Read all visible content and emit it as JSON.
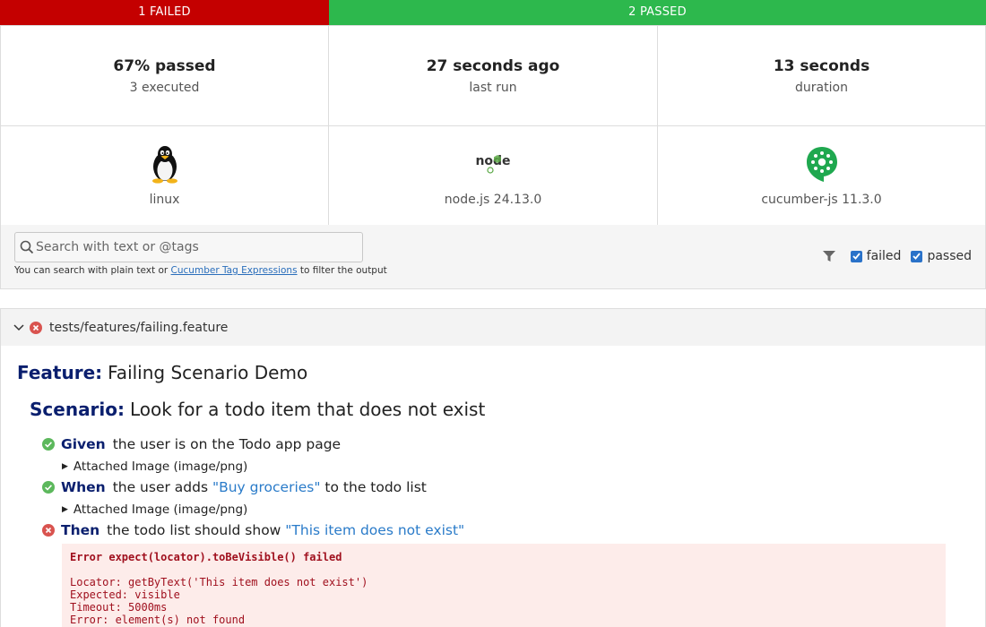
{
  "status_bar": {
    "failed_label": "1 FAILED",
    "passed_label": "2 PASSED",
    "failed_color": "#c40000",
    "passed_color": "#2db84d"
  },
  "stats": {
    "passed_pct": "67% passed",
    "executed": "3 executed",
    "last_run_value": "27 seconds ago",
    "last_run_label": "last run",
    "duration_value": "13 seconds",
    "duration_label": "duration"
  },
  "environment": {
    "os": "linux",
    "os_icon": "linux-tux-icon",
    "runtime": "node.js 24.13.0",
    "runtime_icon": "nodejs-icon",
    "runtime_logo_text": "node",
    "framework": "cucumber-js 11.3.0",
    "framework_icon": "cucumber-icon"
  },
  "search": {
    "placeholder": "Search with text or @tags",
    "help_prefix": "You can search with plain text or ",
    "help_link": "Cucumber Tag Expressions",
    "help_suffix": " to filter the output"
  },
  "filters": {
    "failed_label": "failed",
    "failed_checked": true,
    "passed_label": "passed",
    "passed_checked": true
  },
  "feature_file": {
    "path": "tests/features/failing.feature",
    "status": "failed"
  },
  "feature": {
    "keyword": "Feature:",
    "name": "Failing Scenario Demo"
  },
  "scenario": {
    "keyword": "Scenario:",
    "name": "Look for a todo item that does not exist"
  },
  "steps": [
    {
      "status": "passed",
      "keyword": "Given",
      "text": "the user is on the Todo app page",
      "param": "",
      "suffix": ""
    },
    {
      "status": "passed",
      "keyword": "When",
      "text": "the user adds ",
      "param": "\"Buy groceries\"",
      "suffix": " to the todo list"
    },
    {
      "status": "failed",
      "keyword": "Then",
      "text": "the todo list should show ",
      "param": "\"This item does not exist\"",
      "suffix": ""
    }
  ],
  "attachments": [
    {
      "label": "Attached Image (image/png)"
    },
    {
      "label": "Attached Image (image/png)"
    }
  ],
  "error": {
    "lines": [
      "Error expect(locator).toBeVisible() failed",
      "",
      "Locator: getByText('This item does not exist')",
      "Expected: visible",
      "Timeout: 5000ms",
      "Error: element(s) not found"
    ]
  },
  "colors": {
    "step_passed": "#5cb85c",
    "step_failed": "#d9534f",
    "keyword": "#0a1f6e",
    "param": "#2a7bc9",
    "error_bg": "#fdecea",
    "error_text": "#a0101e"
  }
}
